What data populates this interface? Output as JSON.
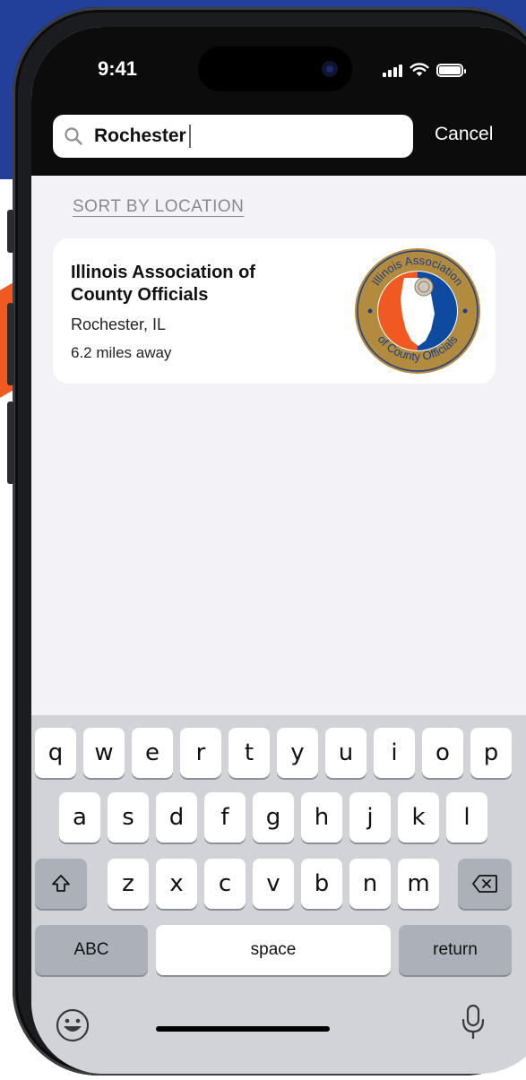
{
  "status_bar": {
    "time": "9:41"
  },
  "search": {
    "value": "Rochester",
    "cancel_label": "Cancel"
  },
  "sort_label": "SORT BY LOCATION",
  "results": [
    {
      "name": "Illinois Association of County Officials",
      "location": "Rochester, IL",
      "distance": "6.2 miles away",
      "logo_text_top": "Illinois Association",
      "logo_text_bottom": "of County Officials"
    }
  ],
  "keyboard": {
    "row1": [
      "q",
      "w",
      "e",
      "r",
      "t",
      "y",
      "u",
      "i",
      "o",
      "p"
    ],
    "row2": [
      "a",
      "s",
      "d",
      "f",
      "g",
      "h",
      "j",
      "k",
      "l"
    ],
    "row3": [
      "z",
      "x",
      "c",
      "v",
      "b",
      "n",
      "m"
    ],
    "abc_label": "ABC",
    "space_label": "space",
    "return_label": "return"
  },
  "colors": {
    "background_blue": "#22409a",
    "accent_orange": "#f05a22",
    "logo_gold": "#b28b3e",
    "logo_blue": "#0e4aa0"
  }
}
